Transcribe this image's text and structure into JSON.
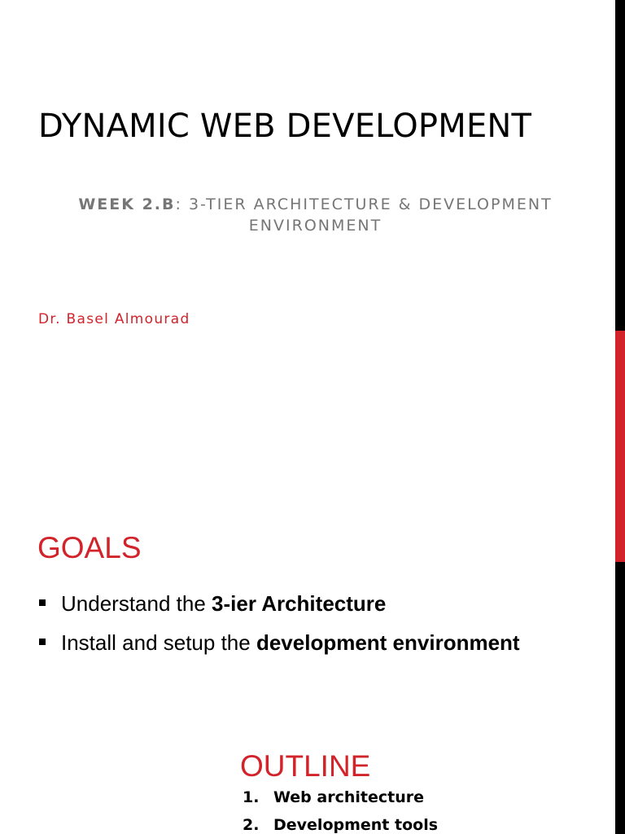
{
  "slides": [
    {
      "title": "DYNAMIC WEB DEVELOPMENT",
      "subtitle_bold": "WEEK 2.B",
      "subtitle_rest": ": 3-TIER ARCHITECTURE & DEVELOPMENT ENVIRONMENT",
      "author": "Dr. Basel Almourad"
    },
    {
      "goals_title": "GOALS",
      "goals": [
        {
          "prefix": "Understand the ",
          "bold": "3-ier Architecture"
        },
        {
          "prefix": "Install and setup the ",
          "bold": "development environment"
        }
      ],
      "outline_title": "OUTLINE",
      "outline": [
        {
          "num": "1.",
          "label": "Web architecture"
        },
        {
          "num": "2.",
          "label": "Development tools"
        }
      ]
    }
  ],
  "colors": {
    "accent": "#d2232a",
    "sidebar": "#000000",
    "subtitle": "#767676"
  }
}
